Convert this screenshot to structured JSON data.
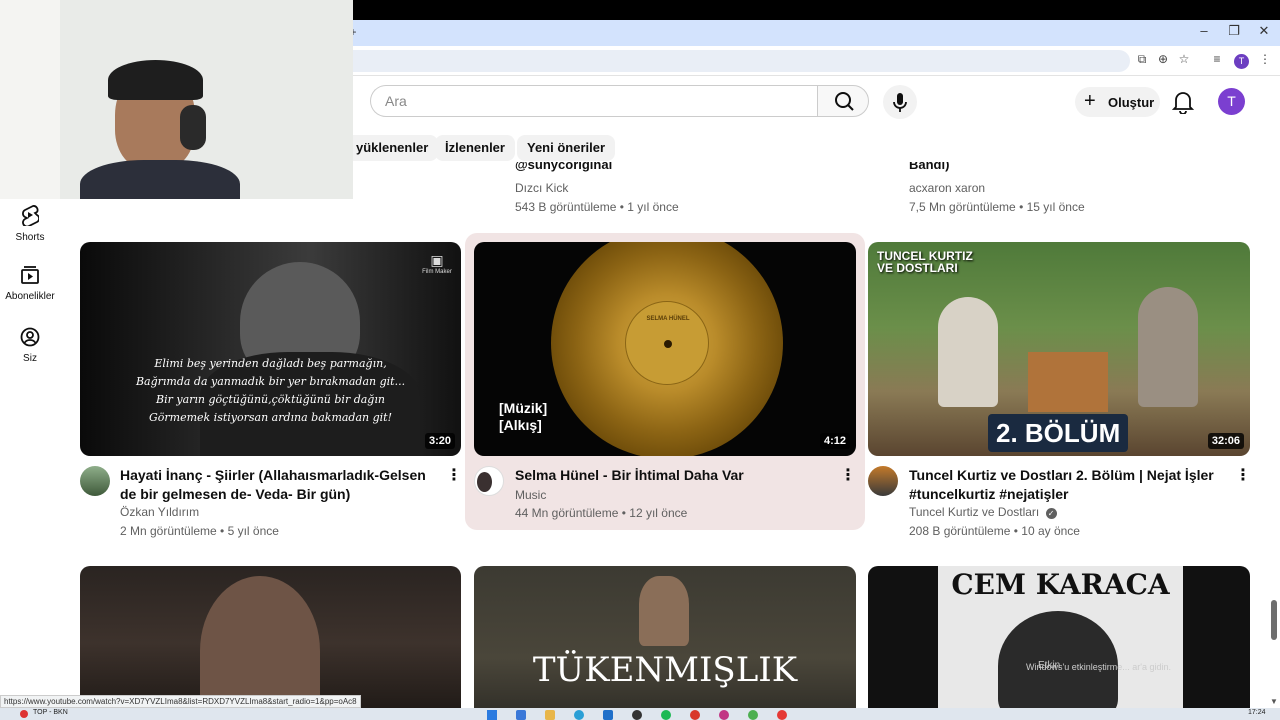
{
  "header": {
    "search_placeholder": "Ara",
    "create_label": "Oluştur",
    "avatar_letter": "T",
    "browser_avatar_letter": "T"
  },
  "chips": [
    {
      "label": "yüklenenler"
    },
    {
      "label": "İzlenenler"
    },
    {
      "label": "Yeni öneriler"
    }
  ],
  "sidebar": {
    "items": [
      {
        "label": "Shorts",
        "icon": "shorts-icon"
      },
      {
        "label": "Abonelikler",
        "icon": "subscriptions-icon"
      },
      {
        "label": "Siz",
        "icon": "you-icon"
      }
    ]
  },
  "prev_row": [
    {
      "title_partial": "@sunycoriginal",
      "channel": "Dızcı Kick",
      "stats": "543 B görüntüleme • 1 yıl önce"
    },
    {
      "title_partial": "Bandı)",
      "channel": "acxaron xaron",
      "stats": "7,5 Mn görüntüleme • 15 yıl önce"
    }
  ],
  "videos": [
    {
      "title": "Hayati İnanç - Şiirler (Allahaısmarladık-Gelsen de bir gelmesen de- Veda- Bir gün)",
      "channel": "Özkan Yıldırım",
      "stats": "2 Mn görüntüleme • 5 yıl önce",
      "duration": "3:20",
      "thumb_badge": "Film Maker",
      "thumb_text": [
        "Elimi beş yerinden dağladı beş parmağın,",
        "Bağrımda da yanmadık bir yer bırakmadan git...",
        "Bir yarın göçtüğünü,çöktüğünü bir dağın",
        "Görmemek istiyorsan ardına bakmadan git!"
      ]
    },
    {
      "title": "Selma Hünel - Bir İhtimal Daha Var",
      "channel": "Music",
      "stats": "44 Mn görüntüleme • 12 yıl önce",
      "duration": "4:12",
      "thumb_text": [
        "[Müzik]",
        "[Alkış]"
      ],
      "record_label": "SELMA HÜNEL"
    },
    {
      "title": "Tuncel Kurtiz ve Dostları 2. Bölüm | Nejat İşler #tuncelkurtiz #nejatişler",
      "channel": "Tuncel Kurtiz ve Dostları",
      "stats": "208 B görüntüleme • 10 ay önce",
      "duration": "32:06",
      "thumb_title": [
        "TUNCEL KURTIZ",
        "VE DOSTLARI"
      ],
      "thumb_episode": "2. BÖLÜM"
    }
  ],
  "next_row": [
    {
      "thumb_text": ""
    },
    {
      "thumb_text": "TÜKENMIŞLIK"
    },
    {
      "thumb_text": "CEM KARACA",
      "overlay_1": "Etkin",
      "overlay_2": "Windows'u etkinleştirme... ar'a gidin."
    }
  ],
  "status_url": "https://www.youtube.com/watch?v=XD7YVZLIma8&list=RDXD7YVZLIma8&start_radio=1&pp=oAc8",
  "taskbar": {
    "left_text": "TOP - BKN",
    "clock": "17:24"
  },
  "colors": {
    "accent_avatar": "#7b3fd0",
    "hover_card": "#f1e4e4",
    "tab_bar": "#d3e3fd"
  }
}
